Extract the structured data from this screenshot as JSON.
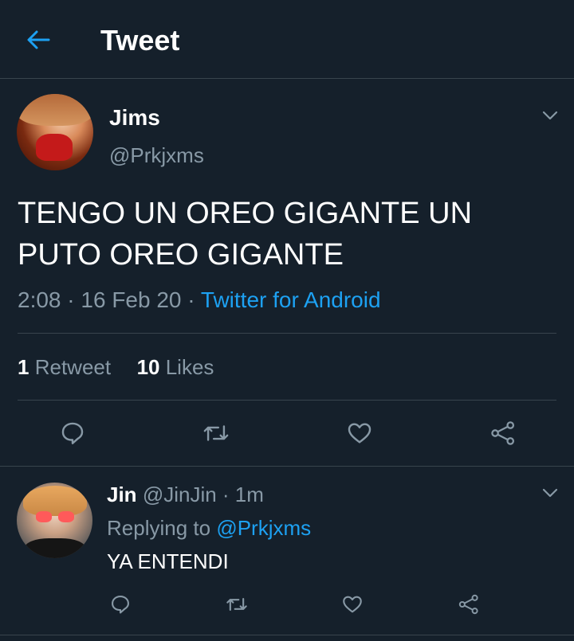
{
  "header": {
    "title": "Tweet",
    "back_icon": "arrow-left-icon",
    "accent_color": "#1da1f2"
  },
  "tweet": {
    "author_name": "Jims",
    "author_handle": "@Prkjxms",
    "text": "TENGO UN OREO GIGANTE UN PUTO OREO GIGANTE",
    "time": "2:08",
    "sep1": " · ",
    "date": "16 Feb 20",
    "sep2": " · ",
    "source": "Twitter for Android",
    "retweets_count": "1",
    "retweets_label": "Retweet",
    "likes_count": "10",
    "likes_label": "Likes"
  },
  "reply": {
    "author_name": "Jin",
    "author_handle": "@JinJin",
    "separator": " · ",
    "time": "1m",
    "replying_label": "Replying to",
    "replying_to": "@Prkjxms",
    "text": "YA ENTENDI"
  },
  "colors": {
    "background": "#15202b",
    "divider": "#38444d",
    "secondary_text": "#8899a6",
    "link": "#1da1f2"
  },
  "icons": [
    "arrow-left-icon",
    "chevron-down-icon",
    "reply-icon",
    "retweet-icon",
    "like-icon",
    "share-icon"
  ]
}
